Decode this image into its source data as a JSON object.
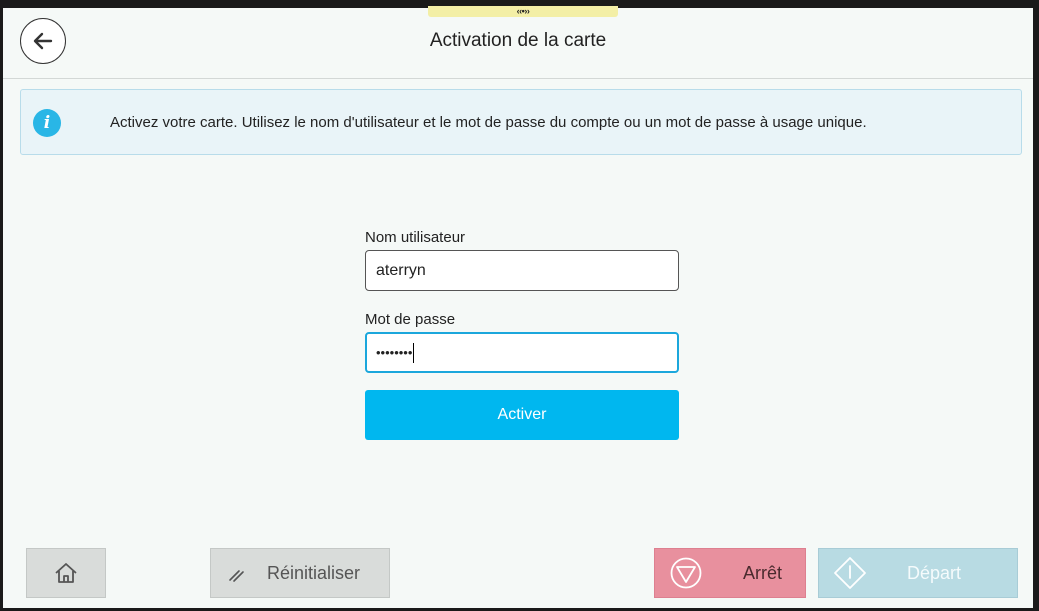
{
  "header": {
    "title": "Activation de la carte",
    "handle_glyph": "‹‹•››"
  },
  "info": {
    "icon": "info-icon",
    "icon_glyph": "i",
    "message": "Activez votre carte. Utilisez le nom d'utilisateur et le mot de passe du compte ou un mot de passe à usage unique."
  },
  "form": {
    "username_label": "Nom utilisateur",
    "username_value": "aterryn",
    "password_label": "Mot de passe",
    "password_value": "••••••••",
    "submit_label": "Activer"
  },
  "footer": {
    "home_icon": "home-icon",
    "reset_label": "Réinitialiser",
    "stop_label": "Arrêt",
    "start_label": "Départ"
  },
  "colors": {
    "accent": "#00b7ef",
    "stop": "#e8909e",
    "start": "#b8dbe3",
    "info_bg": "#e9f4f8"
  }
}
